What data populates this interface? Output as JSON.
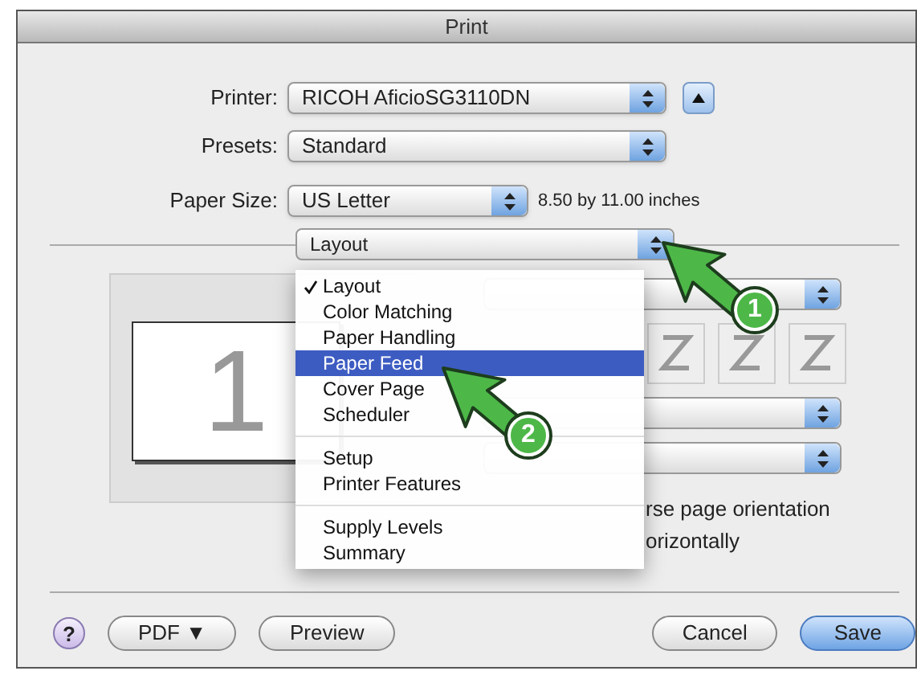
{
  "window": {
    "title": "Print"
  },
  "printer": {
    "label": "Printer:",
    "value": "RICOH AficioSG3110DN"
  },
  "presets": {
    "label": "Presets:",
    "value": "Standard"
  },
  "paper_size": {
    "label": "Paper Size:",
    "value": "US Letter",
    "note": "8.50 by 11.00 inches"
  },
  "panel_popup": {
    "value": "Layout"
  },
  "preview": {
    "page_number": "1"
  },
  "menu": {
    "items": [
      {
        "kind": "item",
        "label": "Layout",
        "checked": true,
        "selected": false
      },
      {
        "kind": "item",
        "label": "Color Matching",
        "checked": false,
        "selected": false
      },
      {
        "kind": "item",
        "label": "Paper Handling",
        "checked": false,
        "selected": false
      },
      {
        "kind": "item",
        "label": "Paper Feed",
        "checked": false,
        "selected": true
      },
      {
        "kind": "item",
        "label": "Cover Page",
        "checked": false,
        "selected": false
      },
      {
        "kind": "item",
        "label": "Scheduler",
        "checked": false,
        "selected": false
      },
      {
        "kind": "separator"
      },
      {
        "kind": "item",
        "label": "Setup",
        "checked": false,
        "selected": false
      },
      {
        "kind": "item",
        "label": "Printer Features",
        "checked": false,
        "selected": false
      },
      {
        "kind": "separator"
      },
      {
        "kind": "item",
        "label": "Supply Levels",
        "checked": false,
        "selected": false
      },
      {
        "kind": "item",
        "label": "Summary",
        "checked": false,
        "selected": false
      }
    ]
  },
  "options": [
    "rse page orientation",
    "orizontally"
  ],
  "callouts": [
    {
      "number": "1"
    },
    {
      "number": "2"
    }
  ],
  "buttons": [
    {
      "kind": "help",
      "label": "?"
    },
    {
      "kind": "plain",
      "label": "PDF ▼"
    },
    {
      "kind": "plain",
      "label": "Preview"
    },
    {
      "kind": "spacer"
    },
    {
      "kind": "plain",
      "label": "Cancel"
    },
    {
      "kind": "default",
      "label": "Save"
    }
  ]
}
